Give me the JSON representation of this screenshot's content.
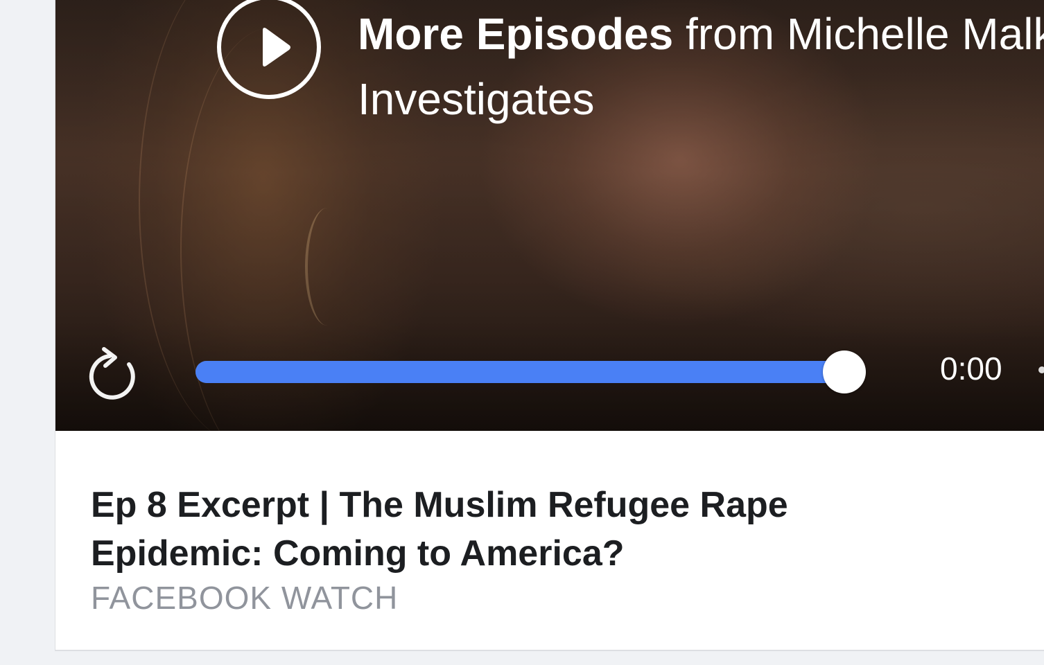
{
  "video": {
    "episodes_heading_strong": "More Episodes",
    "episodes_heading_rest": " from Michelle Malkin Investigates",
    "progress_percent": 100,
    "time": "0:00"
  },
  "post": {
    "title": "Ep 8 Excerpt | The Muslim Refugee Rape Epidemic: Coming to America?",
    "source": "FACEBOOK WATCH"
  },
  "colors": {
    "progress": "#4a80f5",
    "title_text": "#1c1e21",
    "source_text": "#90949c"
  },
  "icons": {
    "play": "play-icon",
    "replay": "replay-icon"
  }
}
